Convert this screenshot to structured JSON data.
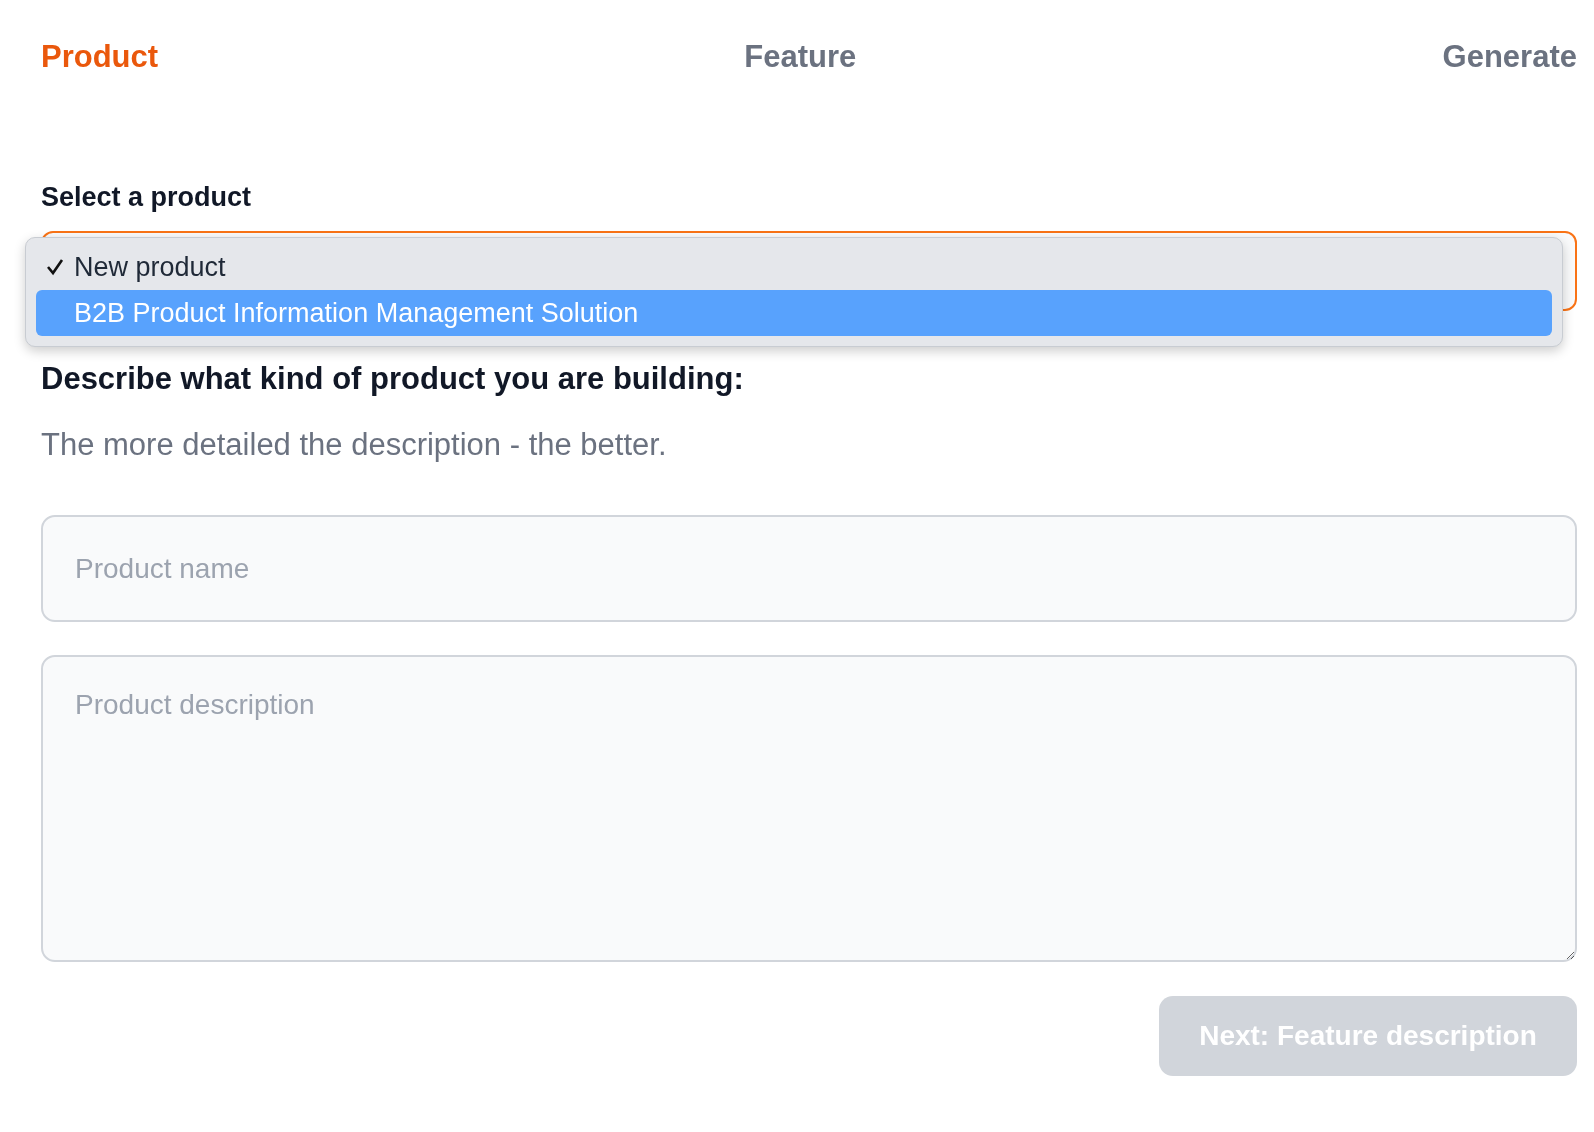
{
  "steps": [
    {
      "label": "Product",
      "selected": true
    },
    {
      "label": "Feature",
      "selected": false
    },
    {
      "label": "Generate",
      "selected": false
    }
  ],
  "product_select": {
    "label": "Select a product",
    "open": true,
    "options": [
      {
        "label": "New product",
        "checked": true,
        "highlighted": false
      },
      {
        "label": "B2B Product Information Management Solution",
        "checked": false,
        "highlighted": true
      }
    ]
  },
  "heading": "Describe what kind of product you are building:",
  "subtitle": "The more detailed the description - the better.",
  "name_field": {
    "placeholder": "Product name"
  },
  "description_field": {
    "placeholder": "Product description"
  },
  "next_button": {
    "label": "Next: Feature description",
    "disabled": true
  }
}
